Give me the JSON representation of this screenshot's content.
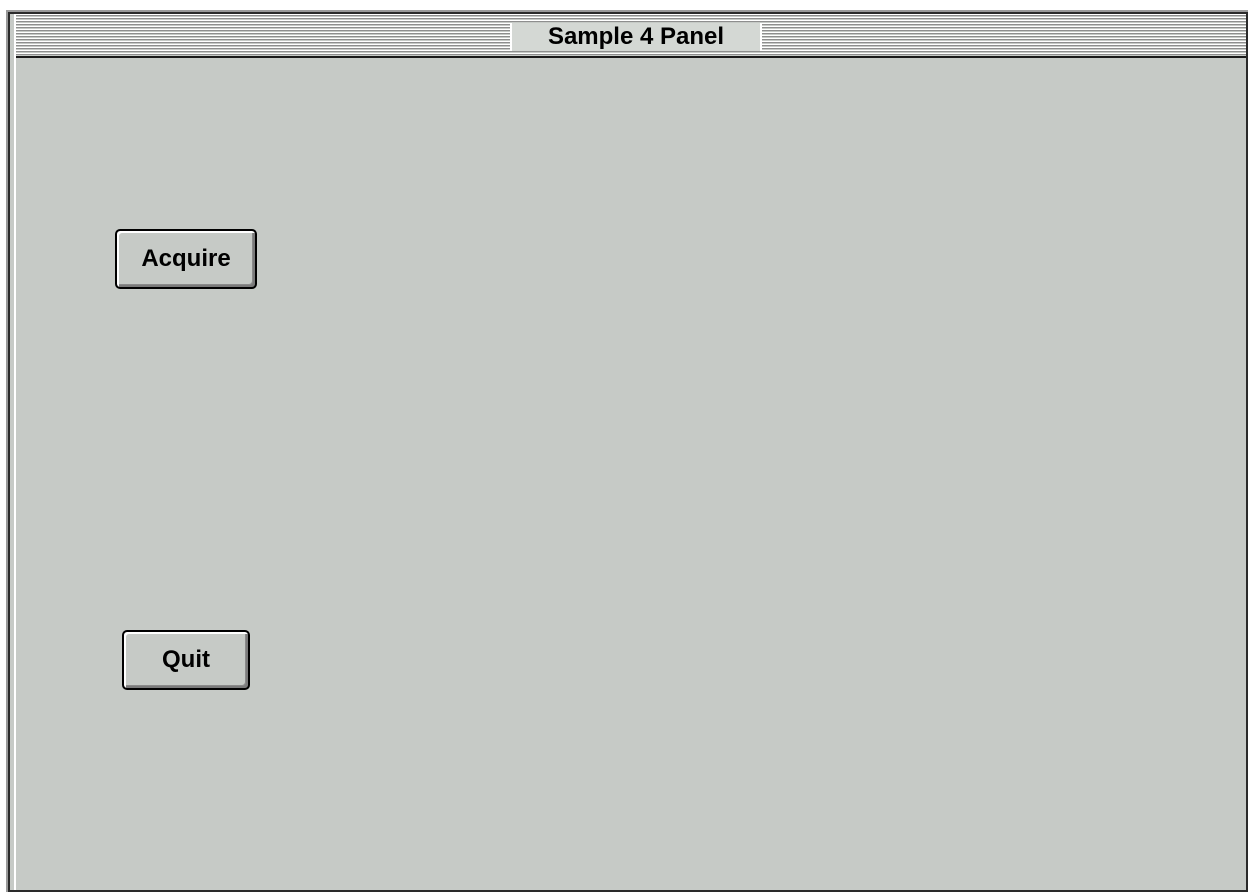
{
  "window": {
    "title": "Sample 4 Panel"
  },
  "buttons": {
    "acquire_label": "Acquire",
    "quit_label": "Quit"
  },
  "colors": {
    "panel_background": "#c6cac6",
    "border": "#2a2a2a",
    "text": "#000000"
  }
}
